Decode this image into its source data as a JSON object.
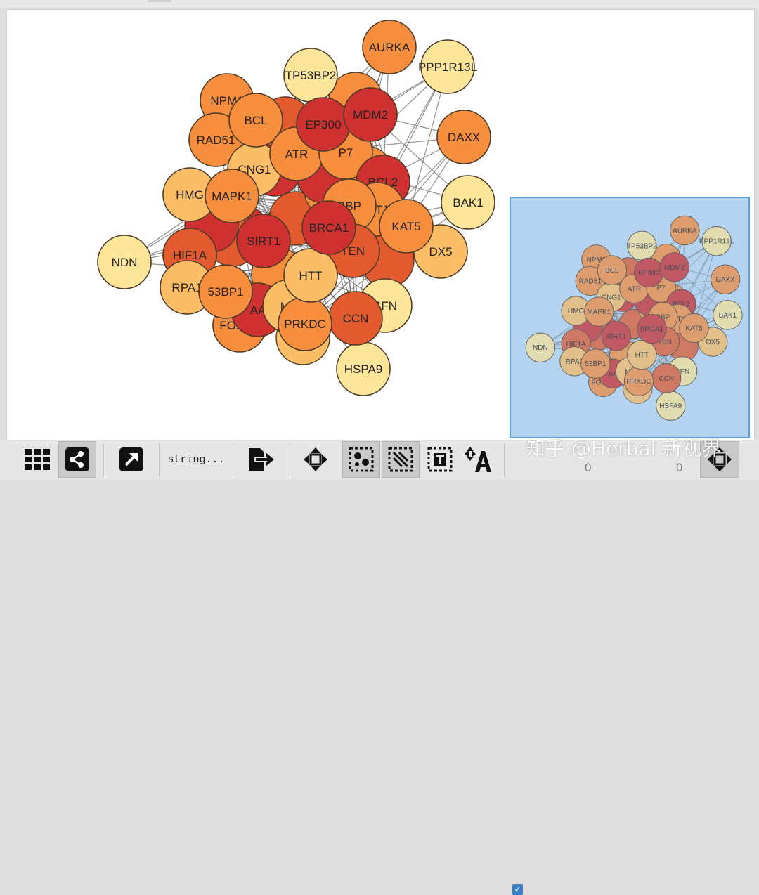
{
  "graph": {
    "colors": {
      "dark_red": "#cf3030",
      "red_orange": "#e25a2e",
      "orange": "#f68e3d",
      "light_orange": "#fbbd66",
      "pale_yellow": "#fde59a",
      "edge": "#6b6b6b",
      "node_border": "#4a3a28"
    },
    "nodes": [
      {
        "label": "AURKA",
        "color": "orange"
      },
      {
        "label": "PPP1R13L",
        "color": "pale_yellow"
      },
      {
        "label": "TP53BP2",
        "color": "pale_yellow"
      },
      {
        "label": "NPM1",
        "color": "orange"
      },
      {
        "label": "BCL",
        "color": "orange"
      },
      {
        "label": "EP300",
        "color": "dark_red"
      },
      {
        "label": "MDM2",
        "color": "dark_red"
      },
      {
        "label": "DAXX",
        "color": "orange"
      },
      {
        "label": "RAD51",
        "color": "orange"
      },
      {
        "label": "ATR",
        "color": "orange"
      },
      {
        "label": "P7",
        "color": "orange"
      },
      {
        "label": "CNG1",
        "color": "light_orange"
      },
      {
        "label": "BCL2",
        "color": "dark_red"
      },
      {
        "label": "BAK1",
        "color": "pale_yellow"
      },
      {
        "label": "HMG",
        "color": "light_orange"
      },
      {
        "label": "MAPK1",
        "color": "orange"
      },
      {
        "label": "BBP",
        "color": "orange"
      },
      {
        "label": "MT1",
        "color": "orange"
      },
      {
        "label": "BRCA1",
        "color": "dark_red"
      },
      {
        "label": "KAT5",
        "color": "orange"
      },
      {
        "label": "NDN",
        "color": "pale_yellow"
      },
      {
        "label": "HIF1A",
        "color": "red_orange"
      },
      {
        "label": "SIRT1",
        "color": "dark_red"
      },
      {
        "label": "TEN",
        "color": "red_orange"
      },
      {
        "label": "DX5",
        "color": "light_orange"
      },
      {
        "label": "RPA1",
        "color": "light_orange"
      },
      {
        "label": "53BP1",
        "color": "orange"
      },
      {
        "label": "HTT",
        "color": "light_orange"
      },
      {
        "label": "SFN",
        "color": "pale_yellow"
      },
      {
        "label": "PRKDC",
        "color": "orange"
      },
      {
        "label": "CCN",
        "color": "red_orange"
      },
      {
        "label": "FOXO3",
        "color": "orange"
      },
      {
        "label": "HSPA9",
        "color": "pale_yellow"
      },
      {
        "label": "MD",
        "color": "light_orange"
      },
      {
        "label": "AA",
        "color": "dark_red"
      }
    ]
  },
  "toolbar": {
    "grid_icon": "grid-icon",
    "share_icon": "network-share-icon",
    "expand_icon": "external-link-icon",
    "string_label": "string...",
    "export_icon": "export-icon",
    "navigate_icon": "move-arrows-icon",
    "select_nodes_icon": "select-nodes-icon",
    "select_edges_icon": "select-edges-icon",
    "select_text_icon": "select-text-icon",
    "text_move_icon": "move-text-icon",
    "fit_icon": "fit-network-icon",
    "counter_left": "0",
    "counter_right": "0"
  },
  "watermark": "知乎 @Herbal 新视界"
}
